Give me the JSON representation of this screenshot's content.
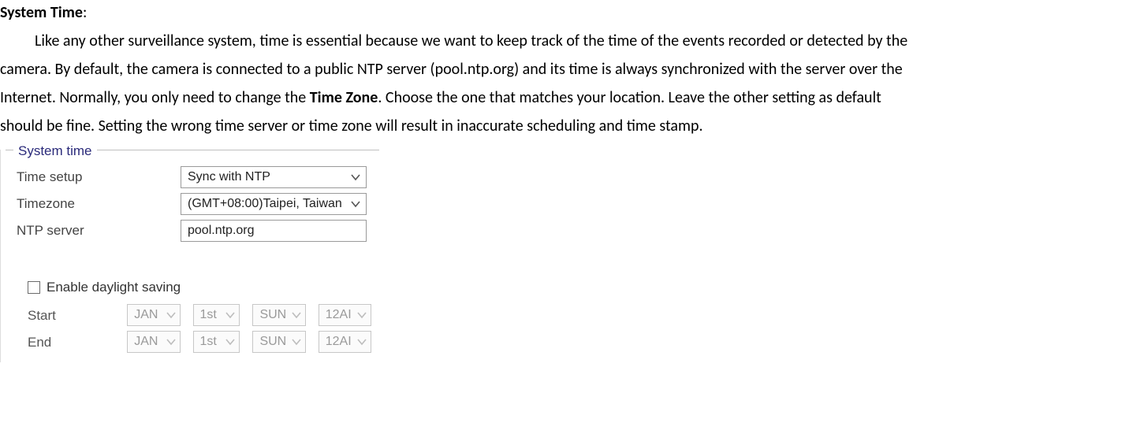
{
  "doc": {
    "heading": "System Time",
    "colon": ":",
    "para_a1": "Like any other surveillance system, time is essential because we want to keep track of the time of the events recorded or detected by the",
    "para_a2": "camera. By default, the camera is connected to a public NTP server (pool.ntp.org) and its time is always synchronized with the server over the",
    "para_a3_pre": "Internet. Normally, you only need to change the ",
    "para_a3_bold": "Time Zone",
    "para_a3_post": ". Choose the one that matches your location. Leave the other setting as default",
    "para_a4": "should be fine. Setting the wrong time server or time zone will result in inaccurate scheduling and time stamp."
  },
  "panel": {
    "legend": "System time",
    "labels": {
      "time_setup": "Time setup",
      "timezone": "Timezone",
      "ntp_server": "NTP server",
      "enable_dst": "Enable daylight saving",
      "start": "Start",
      "end": "End"
    },
    "values": {
      "time_setup": "Sync with NTP",
      "timezone": "(GMT+08:00)Taipei, Taiwan",
      "ntp_server": "pool.ntp.org"
    },
    "dst": {
      "start": {
        "month": "JAN",
        "week": "1st",
        "day": "SUN",
        "hour": "12AI"
      },
      "end": {
        "month": "JAN",
        "week": "1st",
        "day": "SUN",
        "hour": "12AI"
      }
    }
  }
}
